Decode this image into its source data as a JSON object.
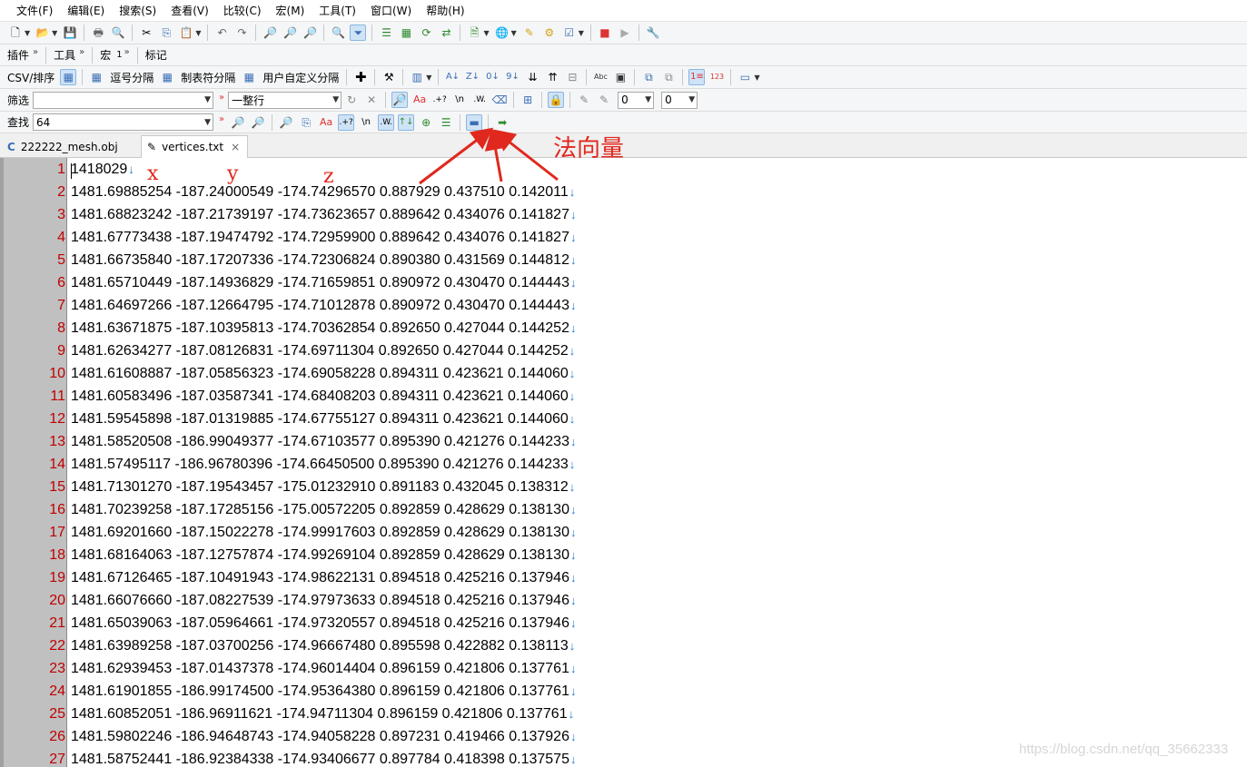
{
  "menu": [
    "文件(F)",
    "编辑(E)",
    "搜索(S)",
    "查看(V)",
    "比较(C)",
    "宏(M)",
    "工具(T)",
    "窗口(W)",
    "帮助(H)"
  ],
  "toolbar2": {
    "plugins": "插件",
    "tools": "工具",
    "macro": "宏",
    "macro_num": "1",
    "marks": "标记"
  },
  "toolbar3": {
    "csv_sort": "CSV/排序",
    "comma_sep": "逗号分隔",
    "tab_sep": "制表符分隔",
    "custom_sep": "用户自定义分隔"
  },
  "filter": {
    "label": "筛选",
    "value": "",
    "mode": "一整行",
    "num1": "0",
    "num2": "0"
  },
  "find": {
    "label": "查找",
    "value": "64"
  },
  "tabs": [
    {
      "label": "222222_mesh.obj",
      "icon": "C"
    },
    {
      "label": "vertices.txt",
      "icon": "✎",
      "close": "×"
    }
  ],
  "eol_symbol": "↓",
  "lines": [
    "1418029",
    "1481.69885254 -187.24000549 -174.74296570 0.887929 0.437510 0.142011",
    "1481.68823242 -187.21739197 -174.73623657 0.889642 0.434076 0.141827",
    "1481.67773438 -187.19474792 -174.72959900 0.889642 0.434076 0.141827",
    "1481.66735840 -187.17207336 -174.72306824 0.890380 0.431569 0.144812",
    "1481.65710449 -187.14936829 -174.71659851 0.890972 0.430470 0.144443",
    "1481.64697266 -187.12664795 -174.71012878 0.890972 0.430470 0.144443",
    "1481.63671875 -187.10395813 -174.70362854 0.892650 0.427044 0.144252",
    "1481.62634277 -187.08126831 -174.69711304 0.892650 0.427044 0.144252",
    "1481.61608887 -187.05856323 -174.69058228 0.894311 0.423621 0.144060",
    "1481.60583496 -187.03587341 -174.68408203 0.894311 0.423621 0.144060",
    "1481.59545898 -187.01319885 -174.67755127 0.894311 0.423621 0.144060",
    "1481.58520508 -186.99049377 -174.67103577 0.895390 0.421276 0.144233",
    "1481.57495117 -186.96780396 -174.66450500 0.895390 0.421276 0.144233",
    "1481.71301270 -187.19543457 -175.01232910 0.891183 0.432045 0.138312",
    "1481.70239258 -187.17285156 -175.00572205 0.892859 0.428629 0.138130",
    "1481.69201660 -187.15022278 -174.99917603 0.892859 0.428629 0.138130",
    "1481.68164063 -187.12757874 -174.99269104 0.892859 0.428629 0.138130",
    "1481.67126465 -187.10491943 -174.98622131 0.894518 0.425216 0.137946",
    "1481.66076660 -187.08227539 -174.97973633 0.894518 0.425216 0.137946",
    "1481.65039063 -187.05964661 -174.97320557 0.894518 0.425216 0.137946",
    "1481.63989258 -187.03700256 -174.96667480 0.895598 0.422882 0.138113",
    "1481.62939453 -187.01437378 -174.96014404 0.896159 0.421806 0.137761",
    "1481.61901855 -186.99174500 -174.95364380 0.896159 0.421806 0.137761",
    "1481.60852051 -186.96911621 -174.94711304 0.896159 0.421806 0.137761",
    "1481.59802246 -186.94648743 -174.94058228 0.897231 0.419466 0.137926",
    "1481.58752441 -186.92384338 -174.93406677 0.897784 0.418398 0.137575"
  ],
  "annotations": {
    "x": "x",
    "y": "y",
    "z": "z",
    "normal": "法向量",
    "color": "#e0281e"
  },
  "watermark": "https://blog.csdn.net/qq_35662333"
}
